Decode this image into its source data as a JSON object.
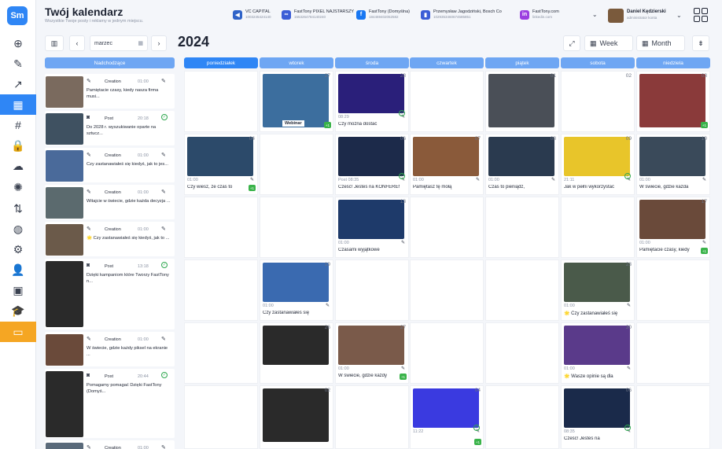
{
  "app": {
    "logo": "Sm",
    "title": "Twój kalendarz",
    "subtitle": "Wszystkie Twoje posty i reklamy w jednym miejscu."
  },
  "rail": {
    "items": [
      {
        "name": "add-post-icon",
        "glyph": "⊕"
      },
      {
        "name": "edit-icon",
        "glyph": "✎"
      },
      {
        "name": "stats-icon",
        "glyph": "↗"
      },
      {
        "name": "calendar-icon",
        "glyph": "▦",
        "active": true
      },
      {
        "name": "hashtag-icon",
        "glyph": "#"
      },
      {
        "name": "lock-icon",
        "glyph": "🔒"
      },
      {
        "name": "chat-icon",
        "glyph": "☁"
      },
      {
        "name": "ai-icon",
        "glyph": "✺"
      },
      {
        "name": "sort-icon",
        "glyph": "⇅"
      },
      {
        "name": "globe-icon",
        "glyph": "◍"
      },
      {
        "name": "settings-icon",
        "glyph": "⚙"
      },
      {
        "name": "user-icon",
        "glyph": "👤"
      },
      {
        "name": "briefcase-icon",
        "glyph": "▣"
      },
      {
        "name": "graduation-icon",
        "glyph": "🎓"
      },
      {
        "name": "presentation-icon",
        "glyph": "▭",
        "highlight": true
      }
    ]
  },
  "accounts": [
    {
      "name": "VC CAPITAL",
      "id": "1003245424140",
      "color": "#2f63c8",
      "glyph": "◀"
    },
    {
      "name": "FastTony PIXEL NAJSTARSZY",
      "id": "1553264784140240",
      "color": "#3b5dd6",
      "glyph": "∞"
    },
    {
      "name": "FastTony (Domyślna)",
      "id": "184469402052582",
      "color": "#1877f2",
      "glyph": "f"
    },
    {
      "name": "Przemysław Jagodziński, Bosch Co",
      "id": "1029353460674585851",
      "color": "#3b5dd6",
      "glyph": "▮"
    },
    {
      "name": "FastTony.com",
      "id": "linkedin.com",
      "color": "#9b3fe0",
      "glyph": "in"
    }
  ],
  "user": {
    "name": "Daniel Kędzierski",
    "sub": "administrator konta"
  },
  "toolbar": {
    "month": "marzec",
    "year": "2024",
    "week_label": "Week",
    "month_label": "Month"
  },
  "upcoming": {
    "header": "Nadchodzące",
    "items": [
      {
        "type": "Creation",
        "time": "01:00",
        "text": "Pamiętacie czasy, kiedy nasza firma musi...",
        "color": "#7a6a5e",
        "icon": "edit"
      },
      {
        "type": "Post",
        "time": "20:18",
        "text": "Do 2028 r. wyszukiwanie oparte na sztucz...",
        "color": "#3f5161",
        "icon": "camera"
      },
      {
        "type": "Creation",
        "time": "01:00",
        "text": "Czy zastanawiałeś się kiedyś, jak to jes...",
        "color": "#4a6a9a",
        "icon": "edit"
      },
      {
        "type": "Creation",
        "time": "01:00",
        "text": "Witajcie w świecie, gdzie każda decyzja ...",
        "color": "#5b6a6e",
        "icon": "edit"
      },
      {
        "type": "Creation",
        "time": "01:00",
        "text": "🌟 Czy zastanawiałeś się kiedyś, jak to ...",
        "color": "#6b5a4a",
        "icon": "edit"
      },
      {
        "type": "Post",
        "time": "13:18",
        "text": "Dzięki kampaniom które Tworzy FastTony n...",
        "color": "#2a2a2a",
        "icon": "camera"
      },
      {
        "type": "Creation",
        "time": "01:00",
        "text": "W świecie, gdzie każdy piksel na ekranie ...",
        "color": "#6a4a3a",
        "icon": "edit"
      },
      {
        "type": "Post",
        "time": "20:44",
        "text": "Pomagamy pomagać Dzięki FastTony (Domyś...",
        "color": "#2a2a2a",
        "icon": "camera"
      },
      {
        "type": "Creation",
        "time": "01:00",
        "text": "",
        "color": "#5a6a7a",
        "icon": "edit"
      }
    ]
  },
  "calendar": {
    "days": [
      "poniedziałek",
      "wtorek",
      "środa",
      "czwartek",
      "piątek",
      "sobota",
      "niedziela"
    ],
    "today_index": 0,
    "rows": [
      [
        {
          "day": ""
        },
        {
          "day": "27",
          "img": "#3c6e9e",
          "label": "Webinar",
          "plus": true
        },
        {
          "day": "28",
          "img": "#2a1f7a",
          "time": "08:29",
          "text": "Czy można dostać",
          "ok": true
        },
        {
          "day": ""
        },
        {
          "day": "01",
          "img": "#4a4f57"
        },
        {
          "day": "02"
        },
        {
          "day": "03",
          "img": "#8a3a3a",
          "plus": true
        }
      ],
      [
        {
          "day": "04",
          "img": "#2c4a6a",
          "time": "01:00",
          "text": "Czy wiesz, że czas to",
          "plus": true
        },
        {
          "day": ""
        },
        {
          "day": "06",
          "img": "#1c2a4a",
          "time": "Post 08:35",
          "text": "Cześć! Jesteś na KONFERENCJI",
          "ok": true
        },
        {
          "day": "07",
          "img": "#8a5a3a",
          "time": "01:00",
          "text": "Pamiętasz tę mołą"
        },
        {
          "day": "08",
          "img": "#2a3a4f",
          "time": "01:00",
          "text": "Czas to pieniądz,"
        },
        {
          "day": "09",
          "img": "#e8c52a",
          "time": "21:11",
          "text": "Jak w pełni wykorzystać",
          "ok": true
        },
        {
          "day": "10",
          "img": "#3a4a5a",
          "time": "01:00",
          "text": "W świecie, gdzie każda"
        }
      ],
      [
        {
          "day": ""
        },
        {
          "day": ""
        },
        {
          "day": "13",
          "img": "#1e3a6a",
          "time": "01:00",
          "text": "Czasami wyjątkowe"
        },
        {
          "day": ""
        },
        {
          "day": ""
        },
        {
          "day": ""
        },
        {
          "day": "17",
          "img": "#6a4a3a",
          "time": "01:00",
          "text": "Pamiętacie czasy, kiedy",
          "plus": true
        }
      ],
      [
        {
          "day": ""
        },
        {
          "day": "19",
          "img": "#3a6ab0",
          "time": "01:00",
          "text": "Czy zastanawiałeś się"
        },
        {
          "day": ""
        },
        {
          "day": ""
        },
        {
          "day": ""
        },
        {
          "day": "23",
          "img": "#4a5a4a",
          "time": "01:00",
          "text": "🌟 Czy zastanawiałeś się"
        },
        {
          "day": ""
        }
      ],
      [
        {
          "day": ""
        },
        {
          "day": "26",
          "img": "#2a2a2a",
          "text": ""
        },
        {
          "day": "27",
          "img": "#7a5a4a",
          "time": "01:00",
          "text": "W świecie, gdzie każdy",
          "plus": true
        },
        {
          "day": ""
        },
        {
          "day": ""
        },
        {
          "day": "30",
          "img": "#5a3a8a",
          "time": "01:00",
          "text": "🌟 Wasze opinie są dla"
        },
        {
          "day": ""
        }
      ],
      [
        {
          "day": ""
        },
        {
          "day": "02",
          "img": "#2a2a2a"
        },
        {
          "day": ""
        },
        {
          "day": "04",
          "img": "#3a3ae0",
          "time": "11:22",
          "ok": true,
          "plus": true
        },
        {
          "day": ""
        },
        {
          "day": "06",
          "img": "#1a2a4a",
          "time": "08:35",
          "text": "Cześć! Jesteś na",
          "ok": true
        },
        {
          "day": ""
        }
      ]
    ]
  }
}
